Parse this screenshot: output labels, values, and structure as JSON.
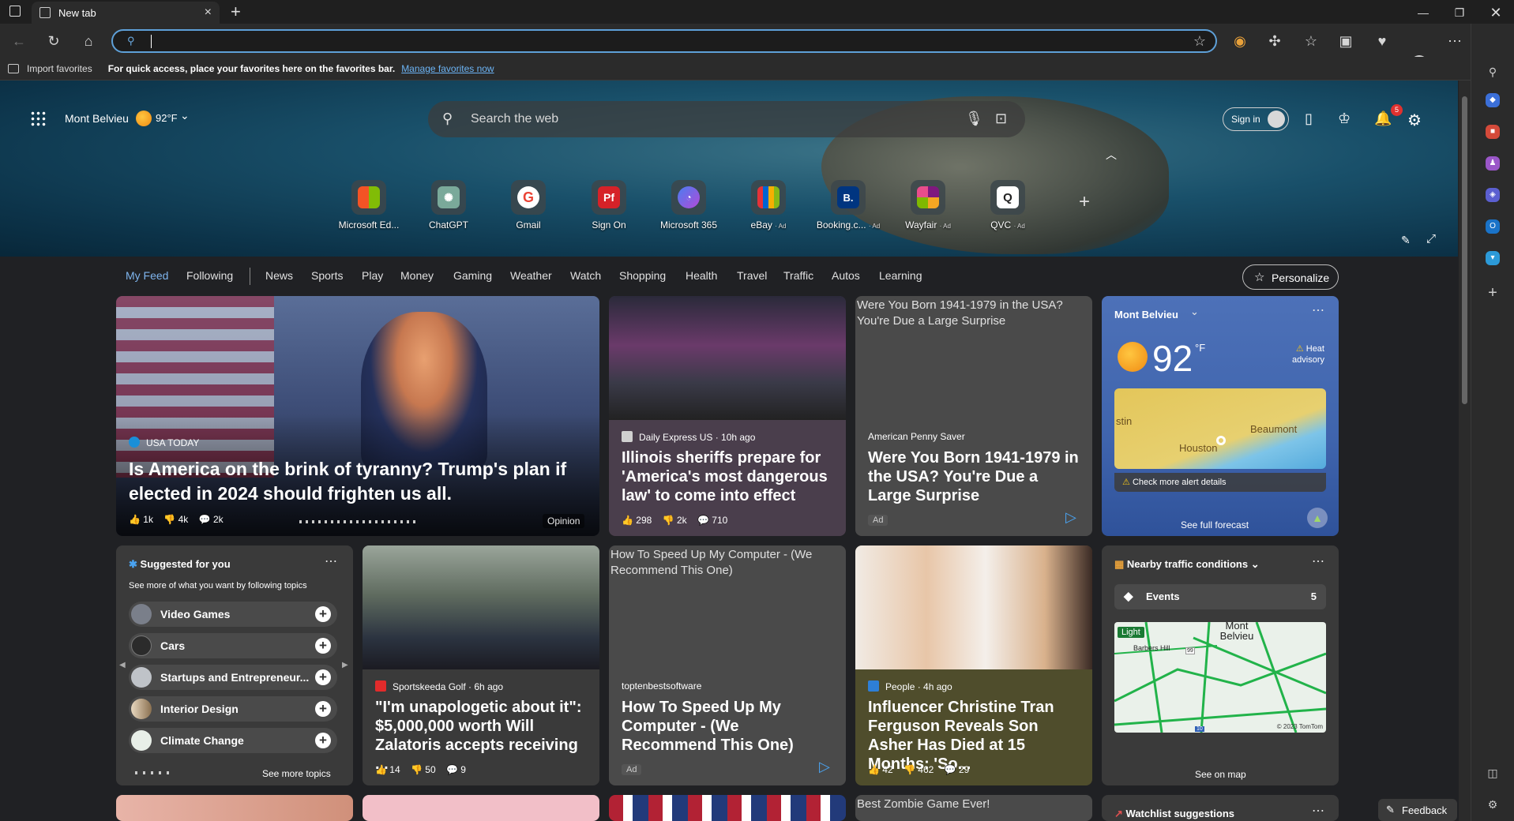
{
  "browser": {
    "tab_title": "New tab",
    "favorites_bar": {
      "import_label": "Import favorites",
      "hint": "For quick access, place your favorites here on the favorites bar.",
      "manage_link": "Manage favorites now"
    }
  },
  "hero": {
    "location": "Mont Belvieu",
    "temperature": "92°F",
    "search_placeholder": "Search the web",
    "sign_in": "Sign in",
    "notification_count": "5",
    "quick_links": [
      {
        "label": "Microsoft Ed...",
        "ad": ""
      },
      {
        "label": "ChatGPT",
        "ad": ""
      },
      {
        "label": "Gmail",
        "ad": ""
      },
      {
        "label": "Sign On",
        "ad": ""
      },
      {
        "label": "Microsoft 365",
        "ad": ""
      },
      {
        "label": "eBay",
        "ad": "· Ad"
      },
      {
        "label": "Booking.c...",
        "ad": "· Ad"
      },
      {
        "label": "Wayfair",
        "ad": "· Ad"
      },
      {
        "label": "QVC",
        "ad": "· Ad"
      }
    ]
  },
  "feed_nav": {
    "items": [
      "My Feed",
      "Following",
      "News",
      "Sports",
      "Play",
      "Money",
      "Gaming",
      "Weather",
      "Watch",
      "Shopping",
      "Health",
      "Travel",
      "Traffic",
      "Autos",
      "Learning"
    ],
    "personalize": "Personalize"
  },
  "cards": {
    "main": {
      "source": "USA TODAY",
      "headline": "Is America on the brink of tyranny? Trump's plan if elected in 2024 should frighten us all.",
      "likes": "1k",
      "dislikes": "4k",
      "comments": "2k",
      "tag": "Opinion"
    },
    "illinois": {
      "source": "Daily Express US · 10h ago",
      "headline": "Illinois sheriffs prepare for 'America's most dangerous law' to come into effect",
      "likes": "298",
      "dislikes": "2k",
      "comments": "710"
    },
    "penny": {
      "alt": "Were You Born 1941-1979 in the USA? You're Due a Large Surprise",
      "source": "American Penny Saver",
      "headline": "Were You Born 1941-1979 in the USA? You're Due a Large Surprise",
      "ad": "Ad"
    },
    "weather": {
      "location": "Mont Belvieu",
      "temp": "92",
      "unit": "°F",
      "alert": "Heat advisory",
      "map_labels": [
        "stin",
        "Beaumont",
        "Houston"
      ],
      "alert_details": "Check more alert details",
      "forecast_button": "See full forecast"
    },
    "suggested": {
      "title": "Suggested for you",
      "subtitle": "See more of what you want by following topics",
      "topics": [
        "Video Games",
        "Cars",
        "Startups and Entrepreneur...",
        "Interior Design",
        "Climate Change"
      ],
      "more": "See more topics"
    },
    "golf": {
      "source": "Sportskeeda Golf · 6h ago",
      "headline": "\"I'm unapologetic about it\": $5,000,000 worth Will Zalatoris accepts receiving ...",
      "likes": "14",
      "dislikes": "50",
      "comments": "9"
    },
    "speed": {
      "alt": "How To Speed Up My Computer - (We Recommend This One)",
      "source": "toptenbestsoftware",
      "headline": "How To Speed Up My Computer - (We Recommend This One)",
      "ad": "Ad"
    },
    "people": {
      "source": "People · 4h ago",
      "headline": "Influencer Christine Tran Ferguson Reveals Son Asher Has Died at 15 Months: 'So...",
      "likes": "42",
      "dislikes": "462",
      "comments": "29"
    },
    "traffic": {
      "title": "Nearby traffic conditions",
      "events_label": "Events",
      "events_count": "5",
      "map_badge": "Light",
      "map_labels": [
        "Mont Belvieu",
        "Barbers Hill",
        "99",
        "10"
      ],
      "copyright": "© 2023 TomTom",
      "map_button": "See on map"
    },
    "zombie": {
      "alt": "Best Zombie Game Ever!"
    },
    "watchlist": {
      "title": "Watchlist suggestions"
    }
  },
  "feedback": "Feedback"
}
